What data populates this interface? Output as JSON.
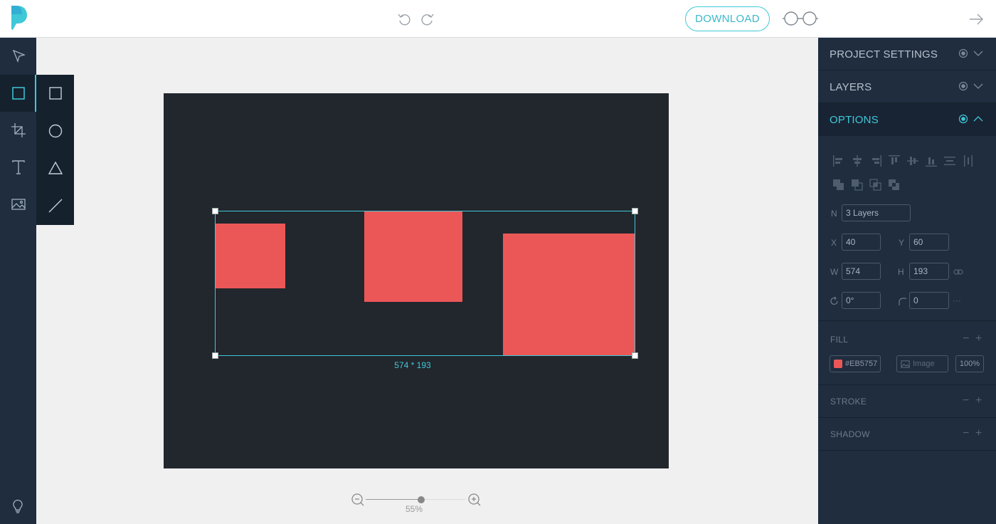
{
  "topbar": {
    "download_label": "DOWNLOAD"
  },
  "canvas": {
    "selection_dimensions": "574 * 193",
    "shape_fill": "#eb5757",
    "artboard_color": "#22262d"
  },
  "zoom": {
    "label": "55%",
    "level": 0.55
  },
  "panel": {
    "sections": {
      "project_settings": "PROJECT SETTINGS",
      "layers": "LAYERS",
      "options": "OPTIONS"
    },
    "props": {
      "name_label": "N",
      "name_value": "3 Layers",
      "x_label": "X",
      "x_value": "40",
      "y_label": "Y",
      "y_value": "60",
      "w_label": "W",
      "w_value": "574",
      "h_label": "H",
      "h_value": "193",
      "rotation_value": "0°",
      "radius_value": "0",
      "more": "···"
    },
    "fill": {
      "title": "FILL",
      "color_value": "#EB5757",
      "image_placeholder": "Image",
      "opacity": "100%"
    },
    "stroke_title": "STROKE",
    "shadow_title": "SHADOW",
    "minus": "−",
    "plus": "+"
  },
  "colors": {
    "accent": "#3fc8d8",
    "panel_bg": "#1f2d3f",
    "toolbar_dark": "#16212e"
  }
}
